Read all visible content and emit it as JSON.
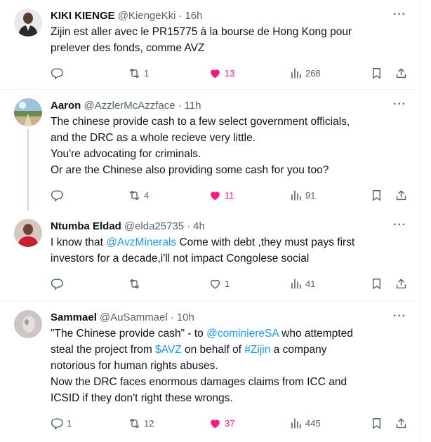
{
  "tweets": [
    {
      "name": "KIKI KIENGE",
      "handle": "@KiengeKki",
      "time": "16h",
      "lines": [
        "Zijin est aller avec le PR15775  à la bourse de Hong Kong pour",
        "prelever des fonds, comme AVZ"
      ],
      "replies": "",
      "retweets": "1",
      "likes": "13",
      "views": "268",
      "liked": true
    },
    {
      "name": "Aaron",
      "handle": "@AzzlerMcAzzface",
      "time": "11h",
      "lines": [
        "The chinese provide cash to a few select government officials,",
        "and the DRC as a whole recieve very little.",
        "You're advocating for criminals.",
        "Or are the Chinese also providing some cash for you too?"
      ],
      "replies": "",
      "retweets": "4",
      "likes": "11",
      "views": "91",
      "liked": true
    },
    {
      "name": "Ntumba Eldad",
      "handle": "@elda25735",
      "time": "4h",
      "line1_a": "I know that ",
      "line1_link": "@AvzMinerals",
      "line1_b": " Come with debt ,they must pays first",
      "line2": "investors for a decade,i'll not impact Congolese social",
      "replies": "",
      "retweets": "",
      "likes": "1",
      "views": "41",
      "liked": false
    },
    {
      "name": "Sammael",
      "handle": "@AuSammael",
      "time": "10h",
      "line1_a": "\"The Chinese provide cash\" - to ",
      "line1_link": "@cominiereSA",
      "line1_b": " who attempted",
      "line2_a": "steal the project from ",
      "line2_link1": "$AVZ",
      "line2_b": " on behalf of ",
      "line2_link2": "#Zijin",
      "line2_c": " a company",
      "line3": "notorious for human rights abuses.",
      "line4": "Now the DRC faces enormous damages claims from ICC and",
      "line5": "ICSID if they don't right these wrongs.",
      "replies": "1",
      "retweets": "12",
      "likes": "37",
      "views": "445",
      "liked": true
    }
  ],
  "separator": "·",
  "colors": {
    "accent": "#1d9bf0",
    "like": "#f91880",
    "muted": "#536471"
  },
  "icons": [
    "reply-icon",
    "retweet-icon",
    "heart-icon",
    "views-icon",
    "bookmark-icon",
    "share-icon",
    "more-icon"
  ]
}
